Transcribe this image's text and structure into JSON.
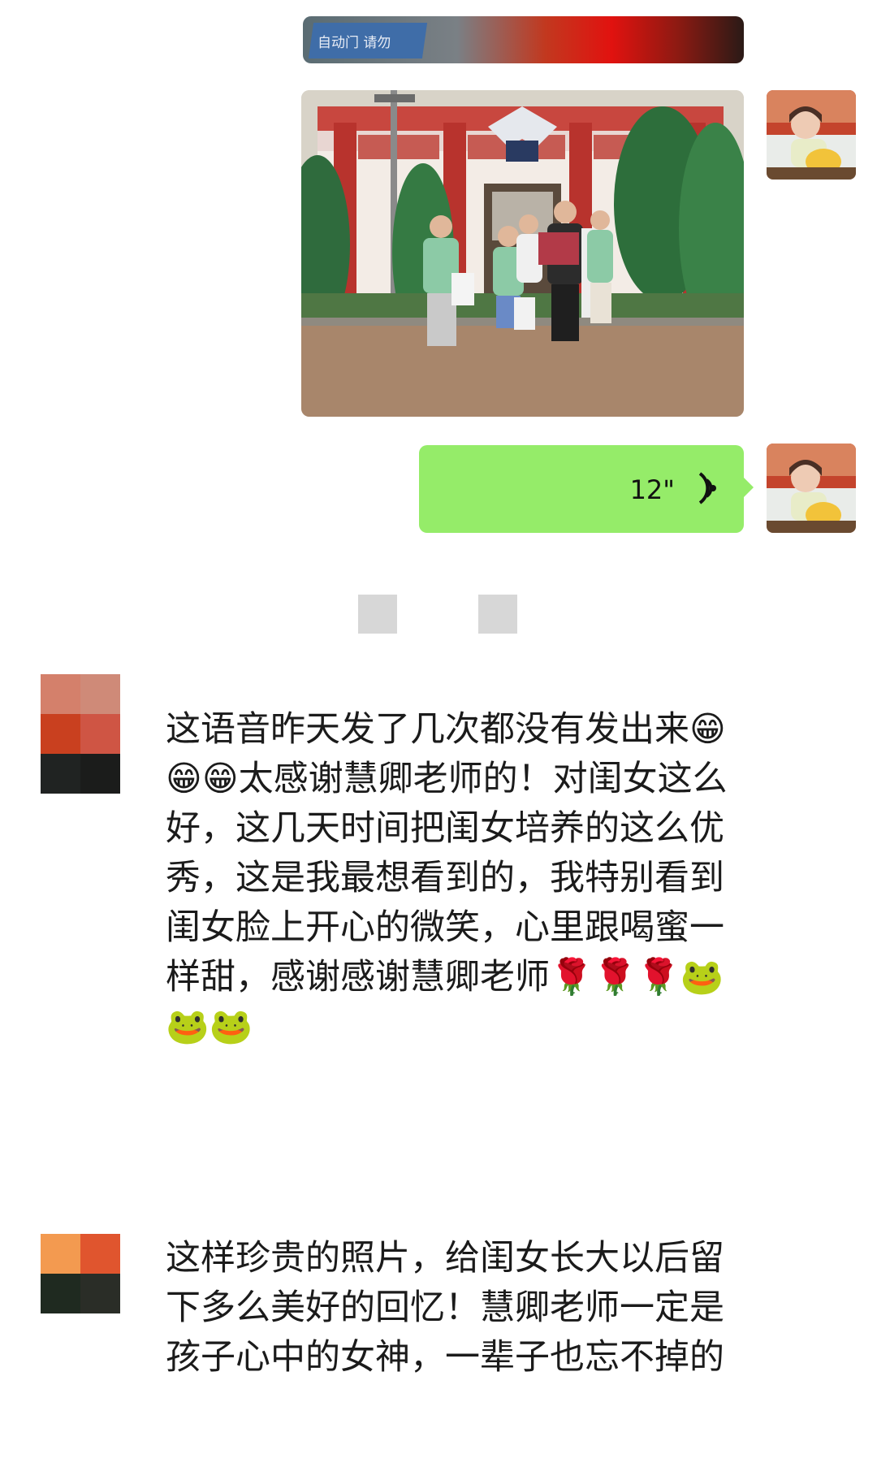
{
  "top_photo": {
    "sign_text": "自动门 请勿"
  },
  "voice_message": {
    "duration": "12\"",
    "icon": "voice-wave-icon"
  },
  "messages": [
    {
      "text": "这语音昨天发了几次都没有发出来😁😁😁太感谢慧卿老师的！对闺女这么好，这几天时间把闺女培养的这么优秀，这是我最想看到的，我特别看到闺女脸上开心的微笑，心里跟喝蜜一样甜，感谢感谢慧卿老师🌹🌹🌹🐸🐸🐸"
    },
    {
      "text": "这样珍贵的照片，给闺女长大以后留下多么美好的回忆！慧卿老师一定是孩子心中的女神，一辈子也忘不掉的"
    }
  ],
  "colors": {
    "voice_bubble": "#95ec69",
    "timestamp_placeholder": "#d7d7d7",
    "text": "#1b1b1b"
  }
}
